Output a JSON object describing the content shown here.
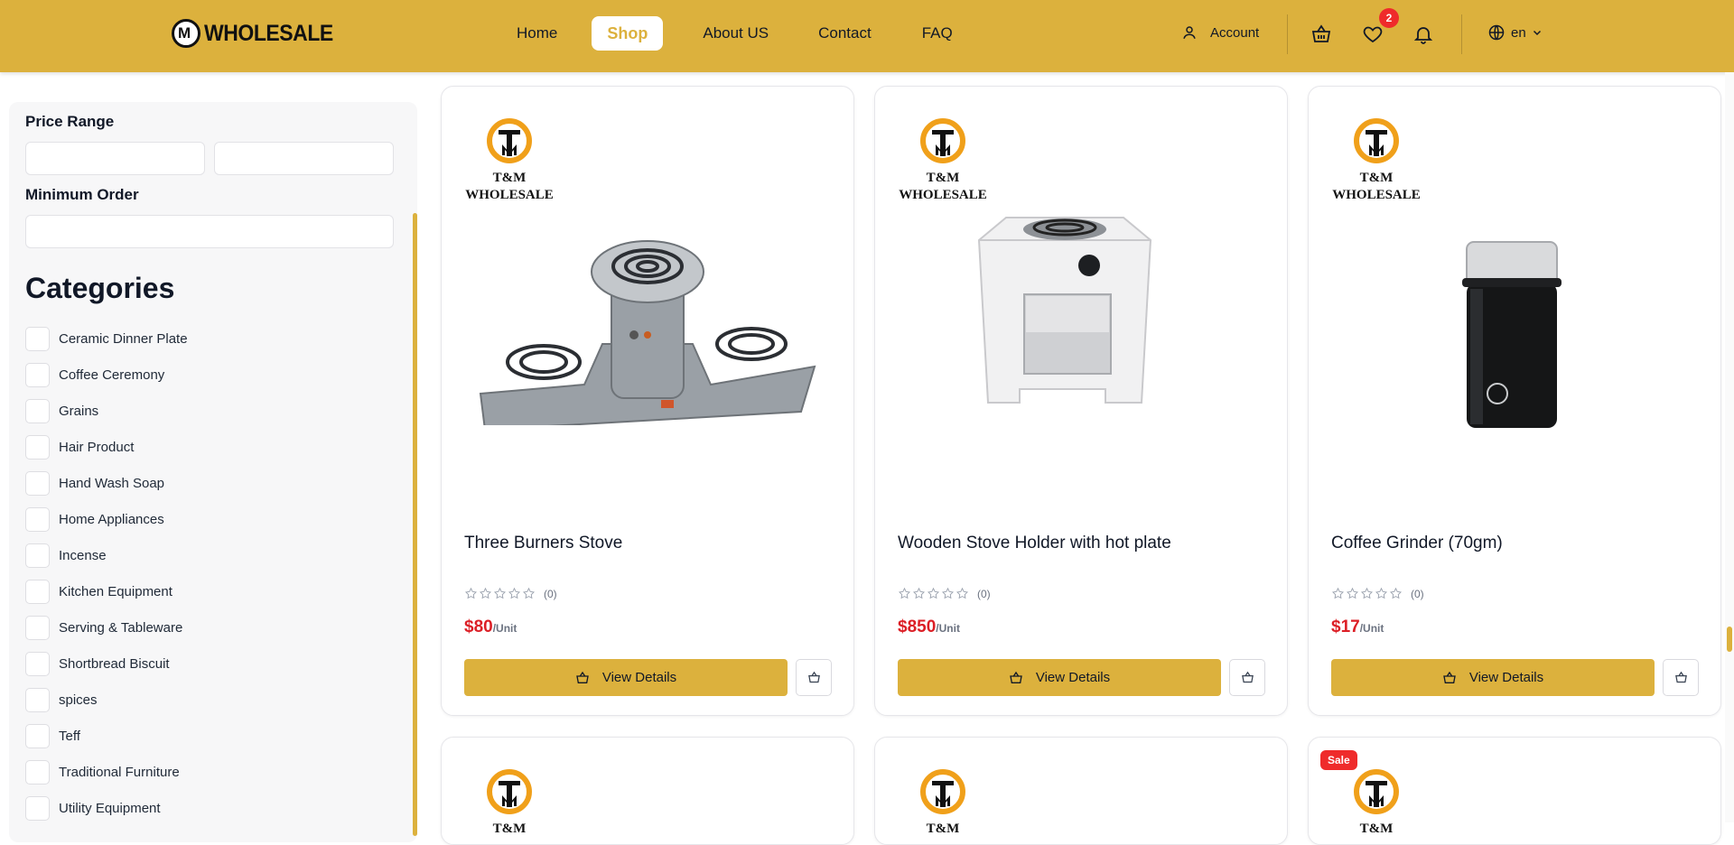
{
  "header": {
    "logo_text": "WHOLESALE",
    "nav": [
      "Home",
      "Shop",
      "About US",
      "Contact",
      "FAQ"
    ],
    "active_nav": "Shop",
    "account_label": "Account",
    "wishlist_count": "2",
    "language": "en"
  },
  "filters": {
    "price_range_label": "Price Range",
    "min_price_value": "",
    "max_price_value": "",
    "minimum_order_label": "Minimum Order",
    "minimum_order_value": ""
  },
  "categories": {
    "title": "Categories",
    "items": [
      "Ceramic Dinner Plate",
      "Coffee Ceremony",
      "Grains",
      "Hair Product",
      "Hand Wash Soap",
      "Home Appliances",
      "Incense",
      "Kitchen Equipment",
      "Serving & Tableware",
      "Shortbread Biscuit",
      "spices",
      "Teff",
      "Traditional Furniture",
      "Utility Equipment"
    ]
  },
  "brand": {
    "line1": "T&M",
    "line2": "WHOLESALE"
  },
  "products": [
    {
      "name": "Three Burners Stove",
      "rating_count": "(0)",
      "rating": 0,
      "price": "$80",
      "unit": "/Unit",
      "view_label": "View Details"
    },
    {
      "name": "Wooden Stove Holder with hot plate",
      "rating_count": "(0)",
      "rating": 0,
      "price": "$850",
      "unit": "/Unit",
      "view_label": "View Details"
    },
    {
      "name": "Coffee Grinder (70gm)",
      "rating_count": "(0)",
      "rating": 0,
      "price": "$17",
      "unit": "/Unit",
      "view_label": "View Details"
    }
  ],
  "second_row": {
    "sale_badge": "Sale"
  },
  "colors": {
    "primary": "#dcb13d",
    "price": "#dc1f26",
    "badge": "#ef2b2b"
  }
}
